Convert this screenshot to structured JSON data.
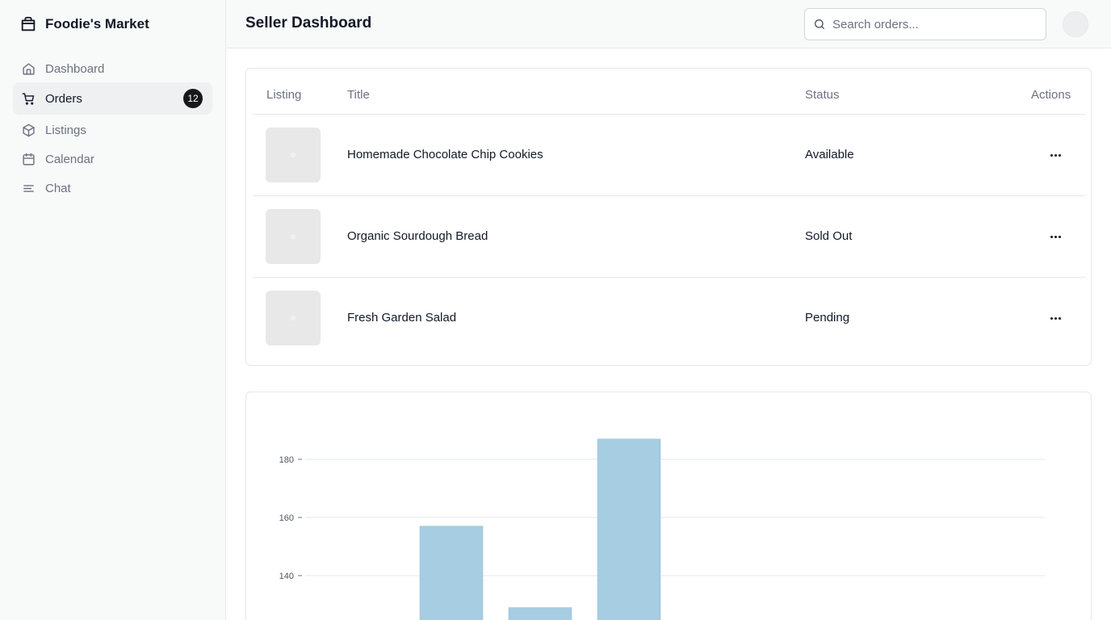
{
  "app": {
    "name": "Foodie's Market"
  },
  "sidebar": {
    "items": [
      {
        "label": "Dashboard",
        "icon": "home-icon"
      },
      {
        "label": "Orders",
        "icon": "cart-icon",
        "badge": "12",
        "active": true
      },
      {
        "label": "Listings",
        "icon": "package-icon"
      },
      {
        "label": "Calendar",
        "icon": "calendar-icon"
      },
      {
        "label": "Chat",
        "icon": "menu-lines-icon"
      }
    ]
  },
  "header": {
    "title": "Seller Dashboard",
    "search_placeholder": "Search orders..."
  },
  "table": {
    "columns": [
      "Listing",
      "Title",
      "Status",
      "Actions"
    ],
    "rows": [
      {
        "title": "Homemade Chocolate Chip Cookies",
        "status": "Available"
      },
      {
        "title": "Organic Sourdough Bread",
        "status": "Sold Out"
      },
      {
        "title": "Fresh Garden Salad",
        "status": "Pending"
      }
    ]
  },
  "colors": {
    "bar": "#a6cde1",
    "badge": "#18181b",
    "grid": "#e5e7eb"
  },
  "chart_data": {
    "type": "bar",
    "yticks": [
      140,
      160,
      180
    ],
    "grid": true,
    "series": [
      {
        "values": [
          157,
          129,
          187
        ]
      }
    ]
  }
}
